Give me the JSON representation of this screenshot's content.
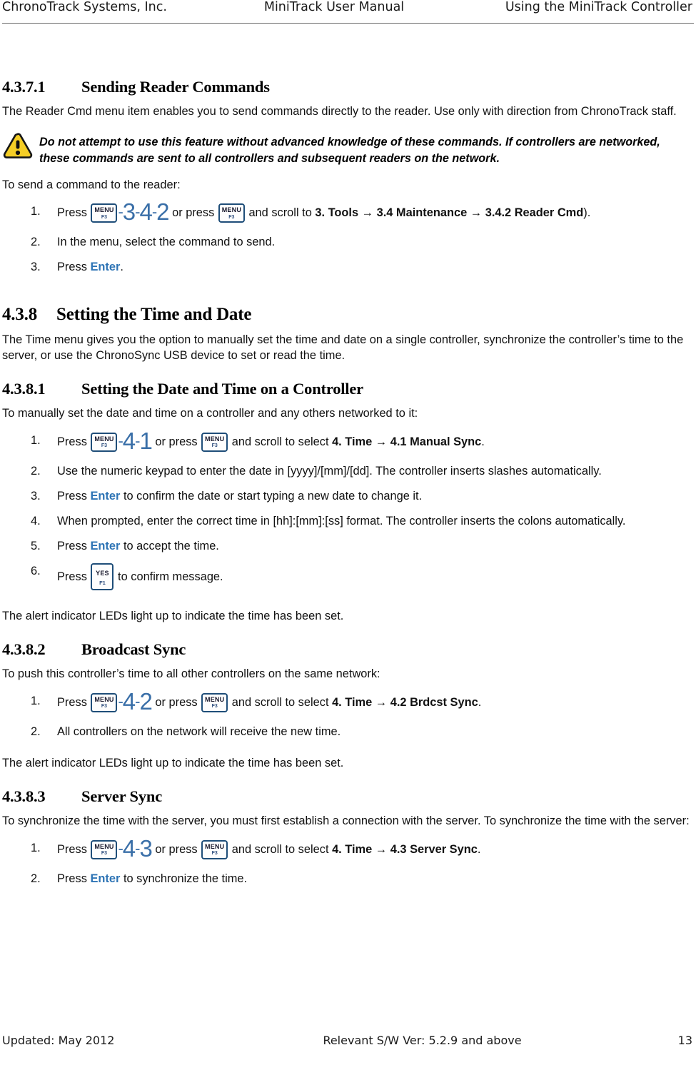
{
  "header": {
    "left": "ChronoTrack Systems, Inc.",
    "center": "MiniTrack User Manual",
    "right": "Using the MiniTrack Controller"
  },
  "footer": {
    "left": "Updated: May 2012",
    "center": "Relevant S/W Ver: 5.2.9 and above",
    "page_number": "13"
  },
  "colors": {
    "key_border": "#1F4E79",
    "digit_blue": "#3A6FA8",
    "link_blue": "#2E74B5",
    "warning_yellow": "#F5CE26",
    "rule_gray": "#6B6B6B"
  },
  "sections": {
    "s4371": {
      "number": "4.3.7.1",
      "title": "Sending Reader Commands",
      "intro": "The Reader Cmd menu item enables you to send commands directly to the reader.  Use only with direction from ChronoTrack staff.",
      "warning": "Do not attempt to use this feature without advanced knowledge of these commands. If controllers are networked, these commands are sent to all controllers and subsequent readers on the network.",
      "lead_in": "To send a command to the reader:",
      "steps": {
        "n1": "1.",
        "n2": "2.",
        "n3": "3.",
        "s1_press": "Press",
        "s1_or_press": "or press",
        "s1_and_scroll": "and scroll to",
        "s1_path": "3. Tools → 3.4 Maintenance → 3.4.2 Reader Cmd",
        "s1_tail": ").",
        "s1_digits": [
          "3",
          "4",
          "2"
        ],
        "s2": "In the menu, select the command to send.",
        "s3_press": "Press",
        "s3_enter": "Enter",
        "s3_tail": "."
      }
    },
    "s438": {
      "number": "4.3.8",
      "title": "Setting the Time and Date",
      "intro": "The Time menu gives you the option to manually set the time and date on a single controller, synchronize the controller’s time to the server, or use the ChronoSync USB device to set or read the time."
    },
    "s4381": {
      "number": "4.3.8.1",
      "title": "Setting the Date and Time on a Controller",
      "lead_in": "To manually set the date and time on a controller and any others networked to it:",
      "steps": {
        "n1": "1.",
        "n2": "2.",
        "n3": "3.",
        "n4": "4.",
        "n5": "5.",
        "n6": "6.",
        "s1_press": "Press",
        "s1_or_press": "or press",
        "s1_and_scroll": "and scroll to select",
        "s1_path": "4. Time → 4.1 Manual Sync",
        "s1_tail": ".",
        "s1_digits": [
          "4",
          "1"
        ],
        "s2": "Use the numeric keypad to enter the date in [yyyy]/[mm]/[dd].  The controller inserts slashes automatically.",
        "s3_press": "Press",
        "s3_enter": "Enter",
        "s3_tail": "to confirm the date or start typing a new date to change it.",
        "s4": "When prompted, enter the correct time in [hh]:[mm]:[ss] format.  The controller inserts the colons automatically.",
        "s5_press": "Press",
        "s5_enter": "Enter",
        "s5_tail": "to accept the time.",
        "s6_press": "Press",
        "s6_tail": "to confirm message."
      },
      "closing": "The alert indicator LEDs light up to indicate the time has been set."
    },
    "s4382": {
      "number": "4.3.8.2",
      "title": "Broadcast Sync",
      "lead_in": "To push this controller’s time to all other controllers on the same network:",
      "steps": {
        "n1": "1.",
        "n2": "2.",
        "s1_press": "Press",
        "s1_or_press": "or press",
        "s1_and_scroll": "and scroll to select",
        "s1_path": "4. Time → 4.2 Brdcst Sync",
        "s1_tail": ".",
        "s1_digits": [
          "4",
          "2"
        ],
        "s2": "All controllers on the network will receive the new time."
      },
      "closing": "The alert indicator LEDs light up to indicate the time has been set."
    },
    "s4383": {
      "number": "4.3.8.3",
      "title": "Server Sync",
      "lead_in": "To synchronize the time with the server, you must first establish a connection with the server. To synchronize the time with the server:",
      "steps": {
        "n1": "1.",
        "n2": "2.",
        "s1_press": "Press",
        "s1_or_press": "or press",
        "s1_and_scroll": "and scroll to select",
        "s1_path": "4. Time → 4.3 Server Sync",
        "s1_tail": ".",
        "s1_digits": [
          "4",
          "3"
        ],
        "s2_press": "Press",
        "s2_enter": "Enter",
        "s2_tail": "to synchronize the time."
      }
    }
  },
  "keys": {
    "menu": {
      "top": "MENU",
      "bottom": "F3"
    },
    "yes": {
      "top": "YES",
      "bottom": "F1"
    }
  }
}
